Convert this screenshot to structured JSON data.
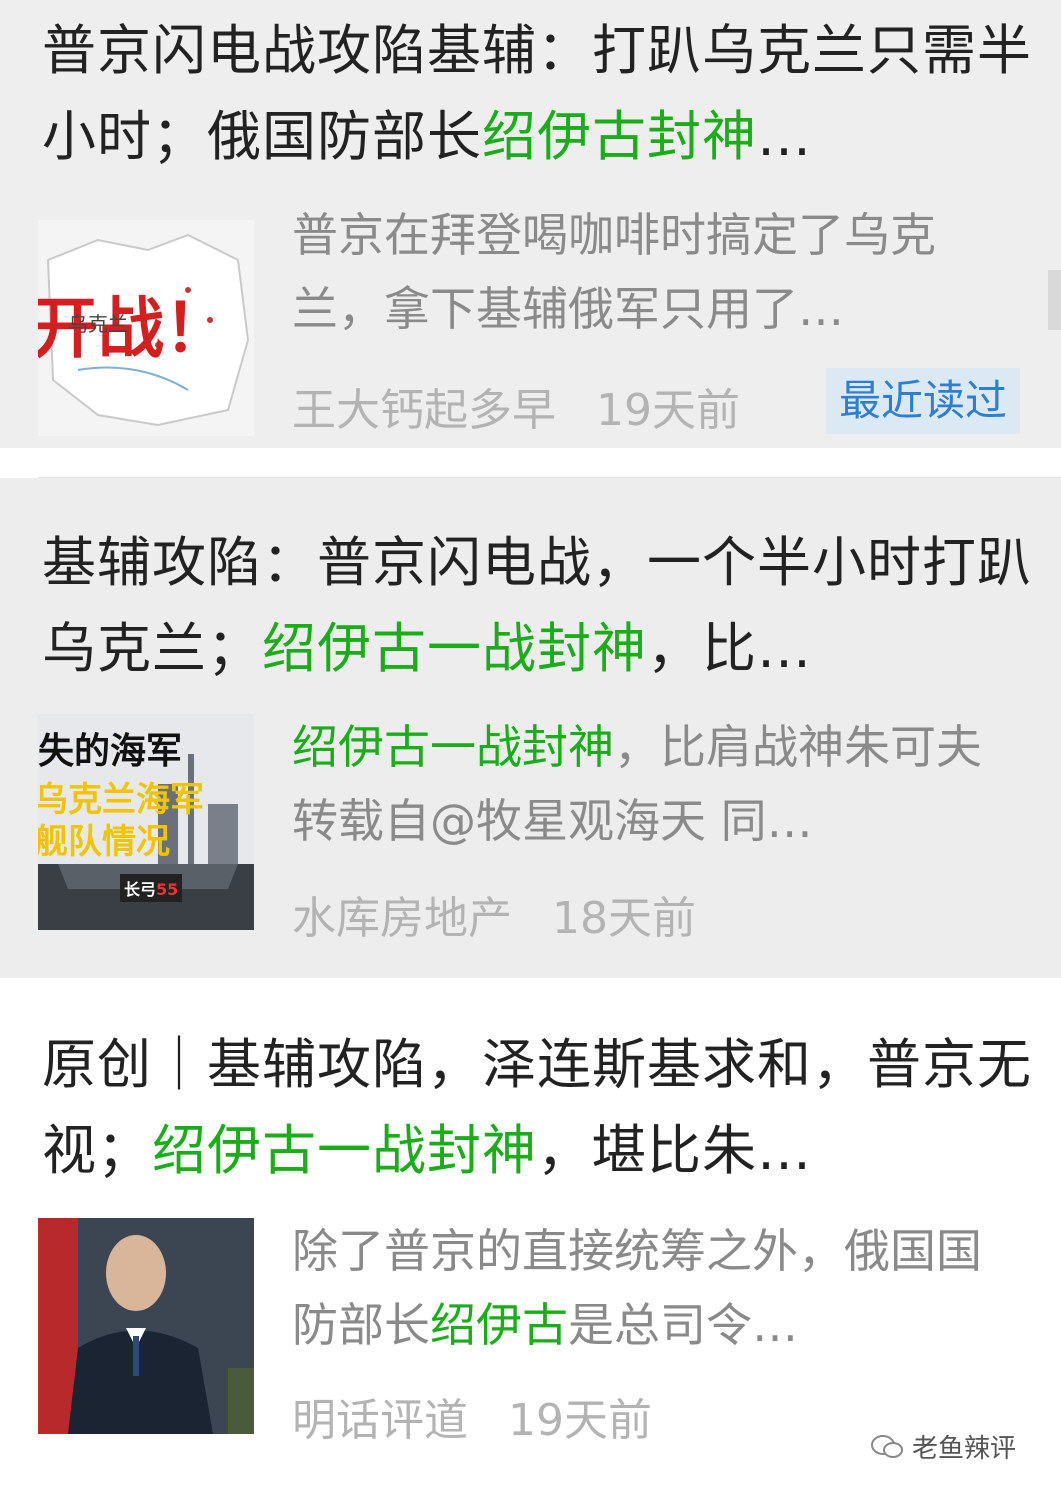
{
  "articles": [
    {
      "title_a": "普京闪电战攻陷基辅：打趴乌克兰只需半小时；俄国防部长",
      "title_hl": "绍伊古封神",
      "title_b": "…",
      "snippet_a": "普京在拜登喝咖啡时搞定了乌克兰，拿下基辅俄军只用了…",
      "snippet_hl": "",
      "snippet_b": "",
      "author": "王大钙起多早",
      "time": "19天前",
      "tag": "最近读过",
      "thumb_text": "开战！",
      "thumb_small": "乌克兰"
    },
    {
      "title_a": "基辅攻陷：普京闪电战，一个半小时打趴乌克兰；",
      "title_hl": "绍伊古一战封神",
      "title_b": "，比…",
      "snippet_a": "",
      "snippet_hl": "绍伊古一战封神",
      "snippet_b": "，比肩战神朱可夫 转载自@牧星观海天 同…",
      "author": "水库房地产",
      "time": "18天前",
      "thumb_line1": "失的海军",
      "thumb_line2": "乌克兰海军",
      "thumb_line3": "舰队情况",
      "thumb_label": "长弓",
      "thumb_label_hl": "55"
    },
    {
      "title_a": "原创｜基辅攻陷，泽连斯基求和，普京无视；",
      "title_hl": "绍伊古一战封神",
      "title_b": "，堪比朱…",
      "snippet_a": "除了普京的直接统筹之外，俄国国防部长",
      "snippet_hl": "绍伊古",
      "snippet_b": "是总司令…",
      "author": "明话评道",
      "time": "19天前"
    }
  ],
  "watermark": "老鱼辣评",
  "colors": {
    "highlight": "#1aad19",
    "tag_bg": "#dbe9f5",
    "tag_fg": "#2f7fd1",
    "meta": "#b3b3b3"
  }
}
